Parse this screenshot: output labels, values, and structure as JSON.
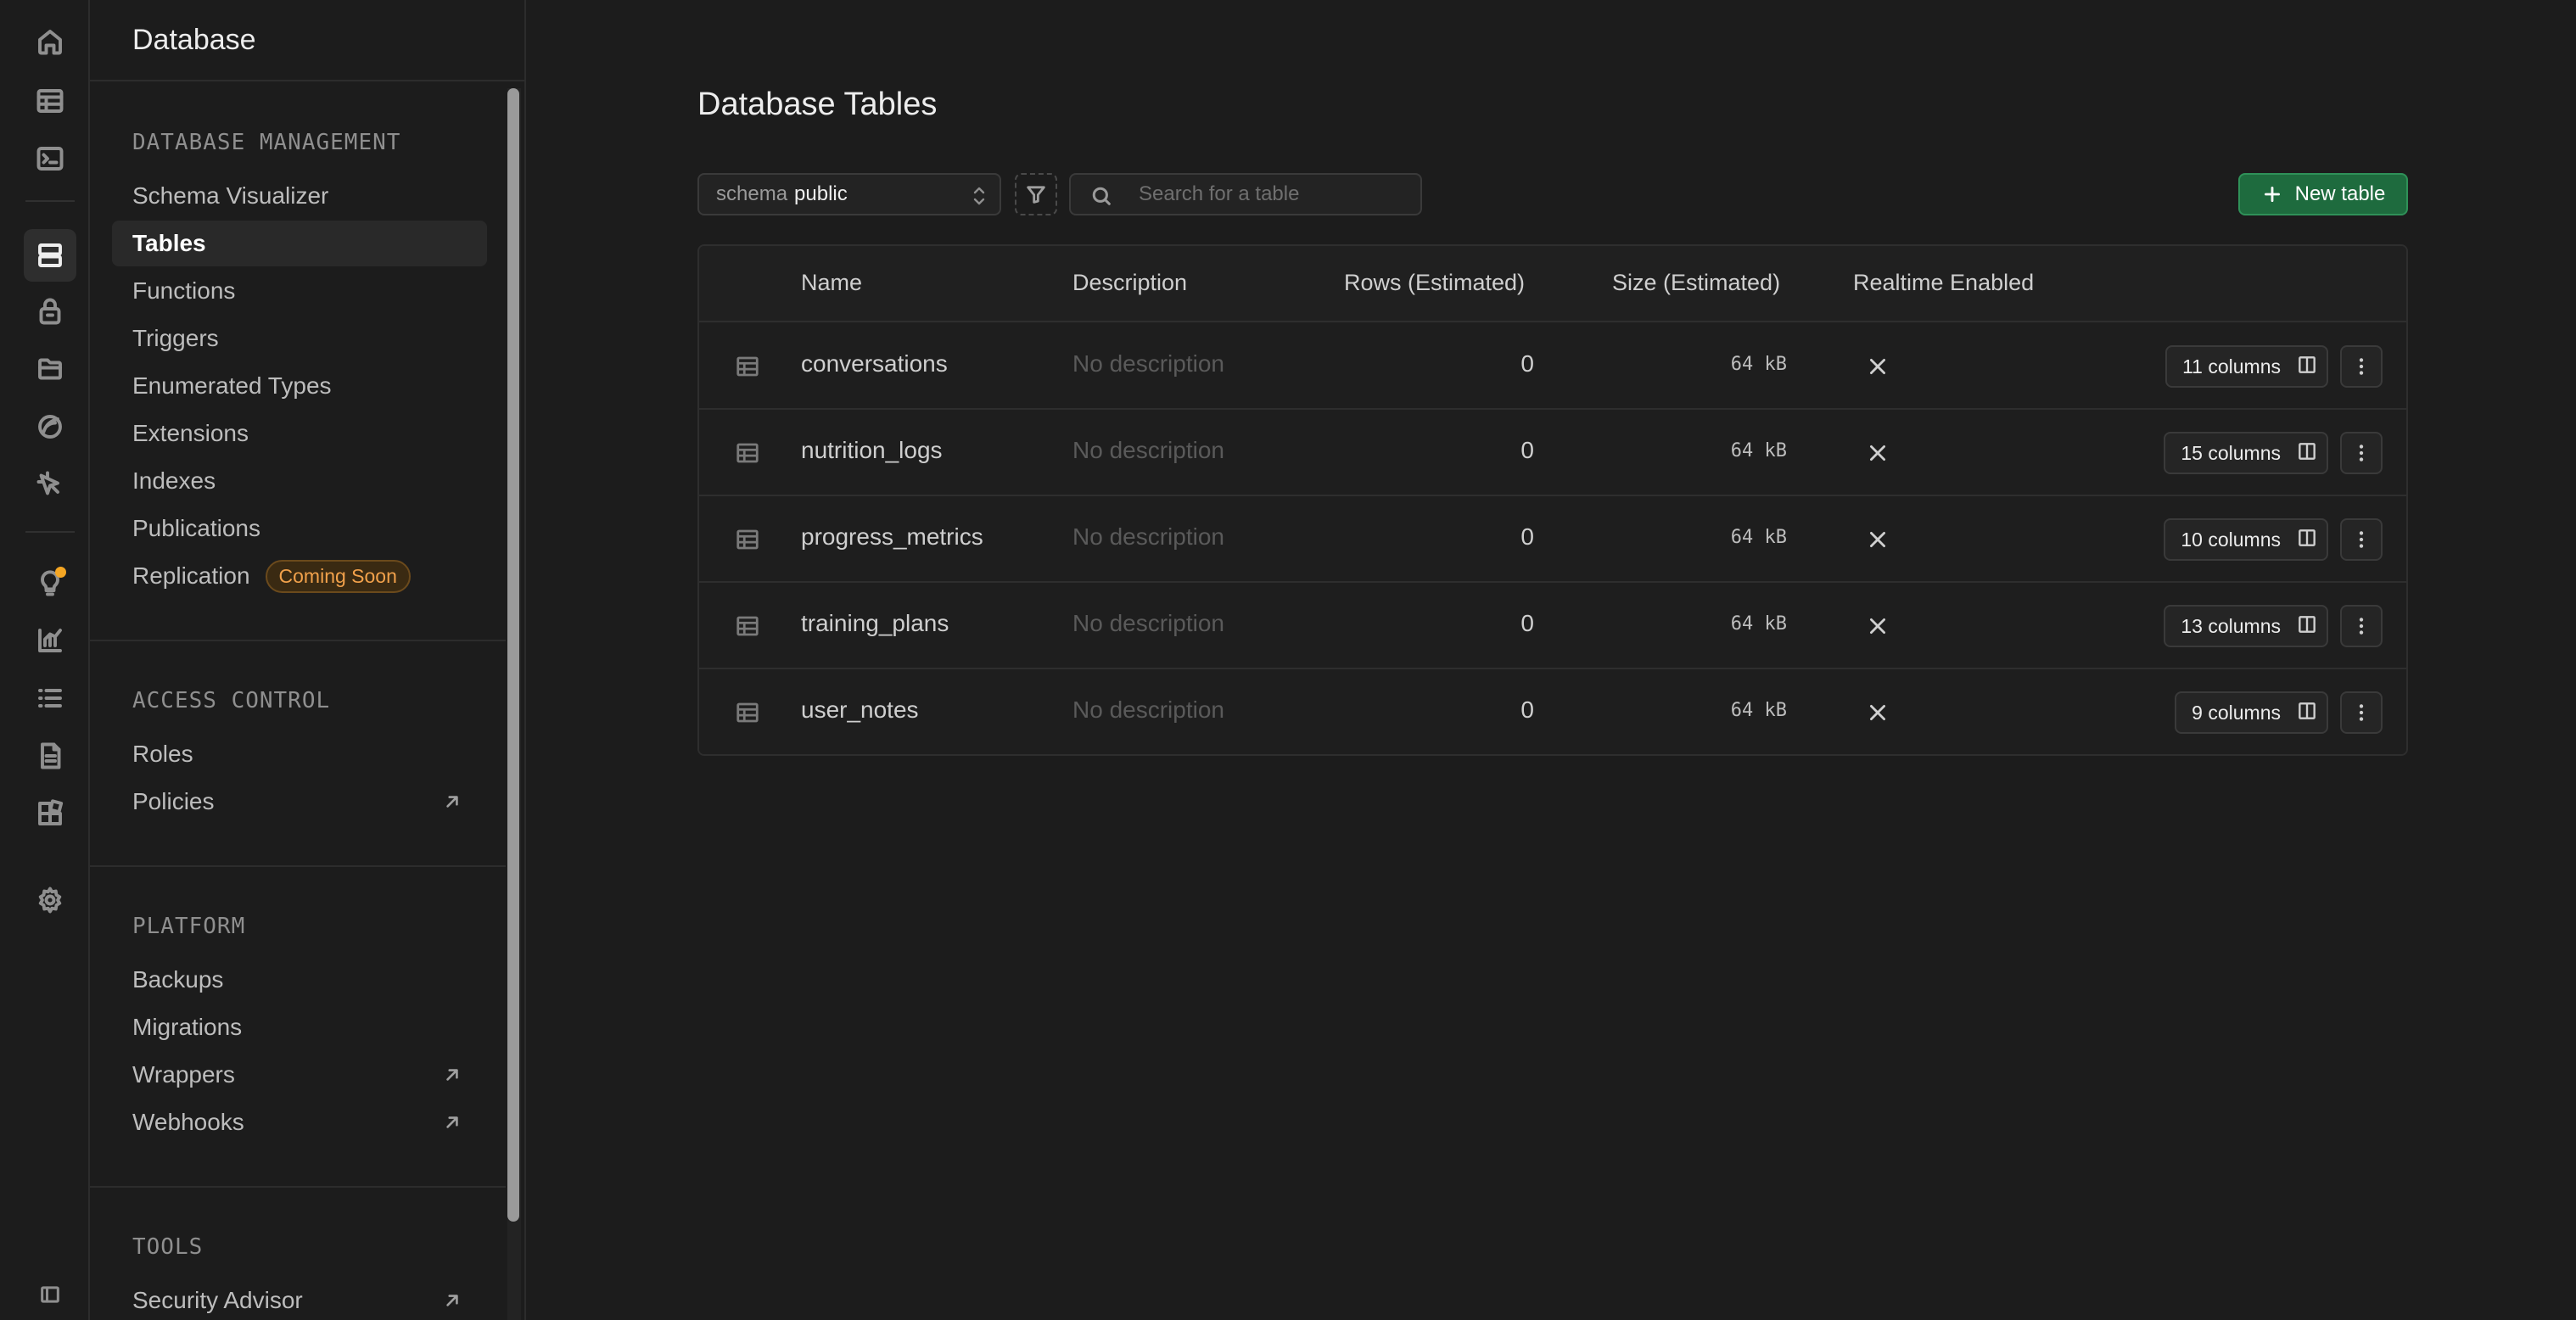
{
  "sidebar": {
    "title": "Database",
    "sections": [
      {
        "title": "DATABASE MANAGEMENT",
        "items": [
          {
            "label": "Schema Visualizer"
          },
          {
            "label": "Tables",
            "active": true
          },
          {
            "label": "Functions"
          },
          {
            "label": "Triggers"
          },
          {
            "label": "Enumerated Types"
          },
          {
            "label": "Extensions"
          },
          {
            "label": "Indexes"
          },
          {
            "label": "Publications"
          },
          {
            "label": "Replication",
            "badge": "Coming Soon"
          }
        ]
      },
      {
        "title": "ACCESS CONTROL",
        "items": [
          {
            "label": "Roles"
          },
          {
            "label": "Policies",
            "external": true
          }
        ]
      },
      {
        "title": "PLATFORM",
        "items": [
          {
            "label": "Backups"
          },
          {
            "label": "Migrations"
          },
          {
            "label": "Wrappers",
            "external": true
          },
          {
            "label": "Webhooks",
            "external": true
          }
        ]
      },
      {
        "title": "TOOLS",
        "items": [
          {
            "label": "Security Advisor",
            "external": true
          }
        ]
      }
    ]
  },
  "rail": {
    "icons": [
      "home-icon",
      "table-editor-icon",
      "sql-editor-icon",
      "database-icon",
      "auth-icon",
      "storage-icon",
      "realtime-icon",
      "edge-functions-icon",
      "advisors-icon",
      "reports-icon",
      "logs-icon",
      "api-docs-icon",
      "integrations-icon",
      "settings-icon",
      "collapse-sidebar-icon"
    ],
    "active": "database-icon"
  },
  "main": {
    "title": "Database Tables",
    "schema_key": "schema",
    "schema_value": "public",
    "search_placeholder": "Search for a table",
    "new_table_label": "New table",
    "columns": {
      "name": "Name",
      "description": "Description",
      "rows": "Rows (Estimated)",
      "size": "Size (Estimated)",
      "realtime": "Realtime Enabled"
    },
    "tables": [
      {
        "name": "conversations",
        "description": "No description",
        "rows": "0",
        "size": "64 kB",
        "columns": "11 columns"
      },
      {
        "name": "nutrition_logs",
        "description": "No description",
        "rows": "0",
        "size": "64 kB",
        "columns": "15 columns"
      },
      {
        "name": "progress_metrics",
        "description": "No description",
        "rows": "0",
        "size": "64 kB",
        "columns": "10 columns"
      },
      {
        "name": "training_plans",
        "description": "No description",
        "rows": "0",
        "size": "64 kB",
        "columns": "13 columns"
      },
      {
        "name": "user_notes",
        "description": "No description",
        "rows": "0",
        "size": "64 kB",
        "columns": "9 columns"
      }
    ]
  },
  "colors": {
    "background": "#1c1c1c",
    "accent_green": "#1e6b3e",
    "badge_orange": "#f1a14b",
    "notification": "#f5a623"
  }
}
